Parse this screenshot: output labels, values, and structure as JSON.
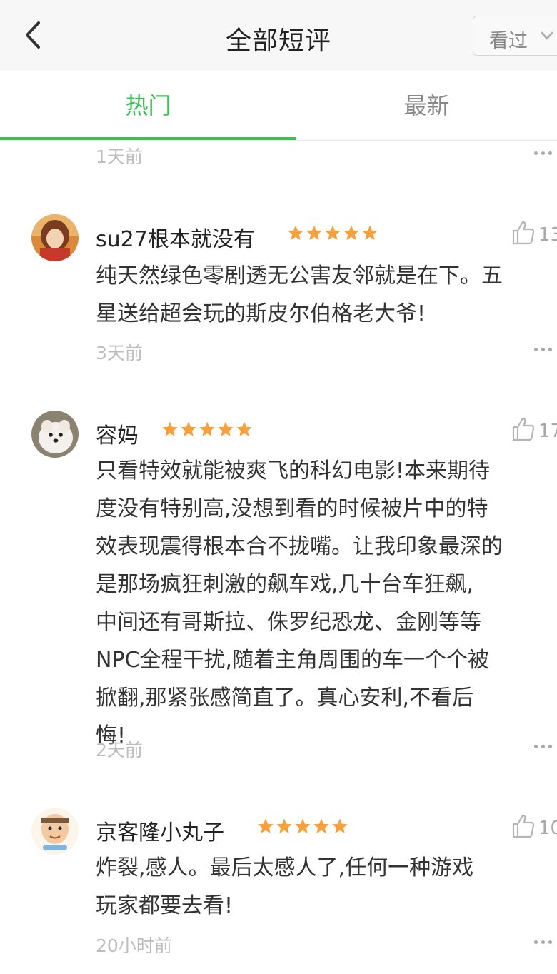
{
  "nav": {
    "title": "全部短评",
    "status_value": "看过",
    "back_icon": "chevron-left-icon",
    "status_icon": "chevron-down-icon"
  },
  "tabs": [
    {
      "label": "热门",
      "active": true
    },
    {
      "label": "最新",
      "active": false
    }
  ],
  "colors": {
    "accent": "#42bd56",
    "star": "#f7a03d",
    "muted": "#bdbdbd"
  },
  "top_partial": {
    "time": "1天前"
  },
  "comments": [
    {
      "username": "su27根本就没有",
      "rating": 5,
      "votes": "13",
      "lines": [
        "纯天然绿色零剧透无公害友邻就是在下。五",
        "星送给超会玩的斯皮尔伯格老大爷!"
      ],
      "time": "3天前"
    },
    {
      "username": "容妈",
      "rating": 5,
      "votes": "17",
      "lines": [
        "只看特效就能被爽飞的科幻电影!本来期待",
        "度没有特别高,没想到看的时候被片中的特",
        "效表现震得根本合不拢嘴。让我印象最深的",
        "是那场疯狂刺激的飙车戏,几十台车狂飙,",
        "中间还有哥斯拉、侏罗纪恐龙、金刚等等",
        "NPC全程干扰,随着主角周围的车一个个被",
        "掀翻,那紧张感简直了。真心安利,不看后",
        "悔!"
      ],
      "time": "2天前"
    },
    {
      "username": "京客隆小丸子",
      "rating": 5,
      "votes": "10",
      "lines": [
        "炸裂,感人。最后太感人了,任何一种游戏",
        "玩家都要去看!"
      ],
      "time": "20小时前"
    }
  ]
}
